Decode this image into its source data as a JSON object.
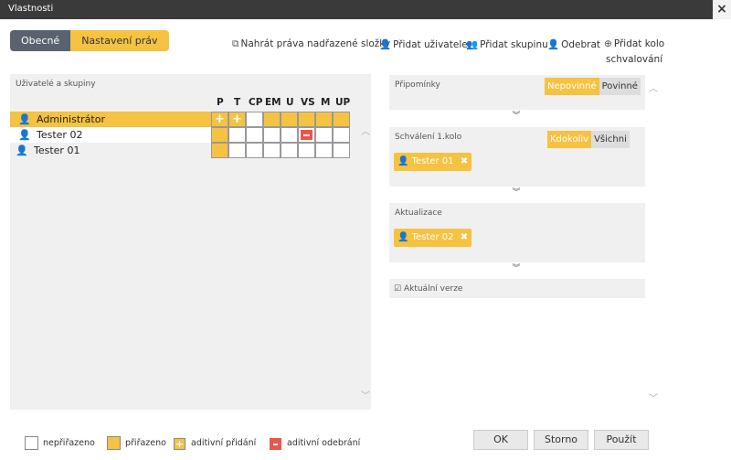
{
  "window": {
    "title": "Vlastnosti",
    "close": "×"
  },
  "tabs": {
    "general": "Obecné",
    "rights": "Nastavení práv"
  },
  "toolbar": {
    "load": "Nahrát práva nadřazené složky",
    "add_user": "Přidat uživatele",
    "add_group": "Přidat skupinu",
    "remove": "Odebrat",
    "add_round_1": "Přidat kolo",
    "add_round_2": "schvalování"
  },
  "users_panel": {
    "header": "Uživatelé a skupiny",
    "columns": [
      "P",
      "T",
      "CP",
      "EM",
      "U",
      "VS",
      "M",
      "UP"
    ],
    "rows": [
      {
        "name": "Administrátor",
        "cells": [
          "plus",
          "plus",
          "empty",
          "assigned",
          "assigned",
          "assigned",
          "assigned",
          "assigned"
        ]
      },
      {
        "name": "Tester 02",
        "cells": [
          "assigned",
          "empty",
          "empty",
          "empty",
          "empty",
          "minus",
          "empty",
          "empty"
        ]
      },
      {
        "name": "Tester 01",
        "cells": [
          "assigned",
          "empty",
          "empty",
          "empty",
          "empty",
          "empty",
          "empty",
          "empty"
        ]
      }
    ]
  },
  "approval": {
    "comments": {
      "title": "Připomínky",
      "opt_on": "Nepovinné",
      "opt_off": "Povinné"
    },
    "round1": {
      "title": "Schválení 1.kolo",
      "opt_on": "Kdokoliv",
      "opt_off": "Všichni",
      "member": "Tester 01"
    },
    "update": {
      "title": "Aktualizace",
      "member": "Tester 02"
    },
    "current": {
      "title": "Aktuální verze"
    }
  },
  "legend": {
    "unassigned": "nepřiřazeno",
    "assigned": "přiřazeno",
    "add": "aditivní přidání",
    "remove": "aditivní odebrání"
  },
  "buttons": {
    "ok": "OK",
    "cancel": "Storno",
    "apply": "Použít"
  },
  "colors": {
    "accent": "#f5c242",
    "tab_inactive": "#5a6270",
    "remove_red": "#e8574d",
    "titlebar": "#3a3a3a"
  }
}
